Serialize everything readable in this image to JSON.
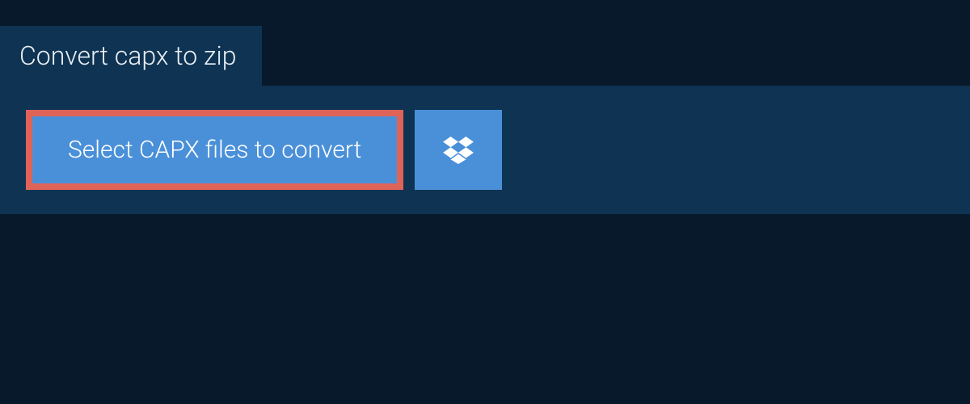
{
  "header": {
    "title": "Convert capx to zip"
  },
  "actions": {
    "select_files_label": "Select CAPX files to convert"
  },
  "colors": {
    "background": "#07192b",
    "panel": "#0f3352",
    "button": "#4a90d9",
    "highlight_border": "#e06358",
    "text_light": "#e8eef3",
    "text_white": "#ffffff"
  }
}
